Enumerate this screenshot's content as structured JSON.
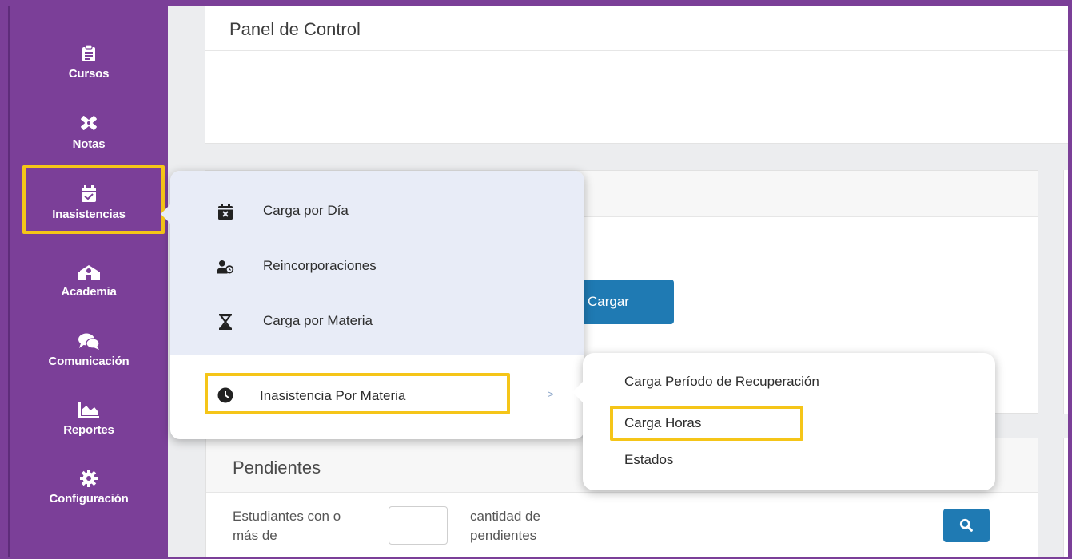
{
  "sidebar": {
    "items": [
      {
        "label": "Cursos",
        "icon": "clipboard-icon"
      },
      {
        "label": "Notas",
        "icon": "pencil-ruler-icon"
      },
      {
        "label": "Inasistencias",
        "icon": "calendar-check-icon"
      },
      {
        "label": "Academia",
        "icon": "school-icon"
      },
      {
        "label": "Comunicación",
        "icon": "comments-icon"
      },
      {
        "label": "Reportes",
        "icon": "area-chart-icon"
      },
      {
        "label": "Configuración",
        "icon": "gear-icon"
      }
    ]
  },
  "main": {
    "panel_title": "Panel de Control",
    "cargar_label": "Cargar",
    "pendientes": {
      "title": "Pendientes",
      "label_left": "Estudiantes con o más de",
      "label_right": "cantidad de pendientes",
      "input_value": ""
    }
  },
  "menu": {
    "items": [
      {
        "label": "Carga por Día",
        "icon": "calendar-x-icon"
      },
      {
        "label": "Reincorporaciones",
        "icon": "user-clock-icon"
      },
      {
        "label": "Carga por Materia",
        "icon": "hourglass-icon"
      },
      {
        "label": "Inasistencia Por Materia",
        "icon": "clock-icon"
      }
    ],
    "submenu_indicator": ">"
  },
  "submenu": {
    "items": [
      {
        "label": "Carga Período de Recuperación"
      },
      {
        "label": "Carga Horas"
      },
      {
        "label": "Estados"
      }
    ]
  },
  "colors": {
    "sidebar": "#7b3f98",
    "highlight": "#f5c518",
    "button": "#1f7ab3",
    "menu_bg": "#e8ecf7"
  }
}
